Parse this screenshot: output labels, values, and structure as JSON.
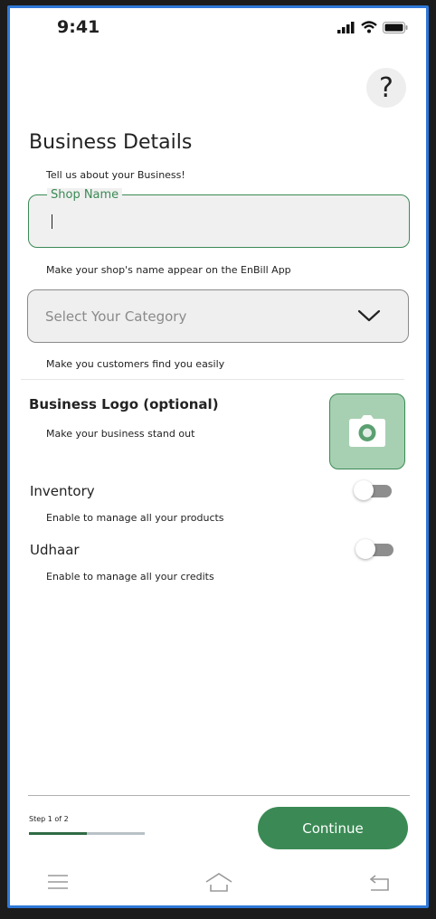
{
  "status_bar": {
    "time": "9:41"
  },
  "help": {
    "symbol": "?"
  },
  "page": {
    "title": "Business Details",
    "subtitle": "Tell us about your Business!"
  },
  "shop_name": {
    "label": "Shop Name",
    "value": "",
    "helper": "Make your shop's name appear on the EnBill App"
  },
  "category": {
    "placeholder": "Select Your Category",
    "helper": "Make you customers find you easily"
  },
  "logo": {
    "title": "Business Logo (optional)",
    "helper": "Make your business stand out"
  },
  "inventory": {
    "title": "Inventory",
    "helper": "Enable to manage all your products",
    "enabled": false
  },
  "udhaar": {
    "title": "Udhaar",
    "helper": "Enable to manage all your credits",
    "enabled": false
  },
  "footer": {
    "step_text": "Step 1 of 2",
    "progress": 0.5,
    "continue_label": "Continue"
  },
  "colors": {
    "accent": "#3b8a55",
    "accent_light": "#a7d0b2",
    "progress_track": "#b8c2c6",
    "frame": "#2f78d8"
  },
  "icons": [
    "signal-icon",
    "wifi-icon",
    "battery-icon",
    "chevron-down-icon",
    "camera-icon",
    "menu-icon",
    "home-icon",
    "back-icon"
  ]
}
